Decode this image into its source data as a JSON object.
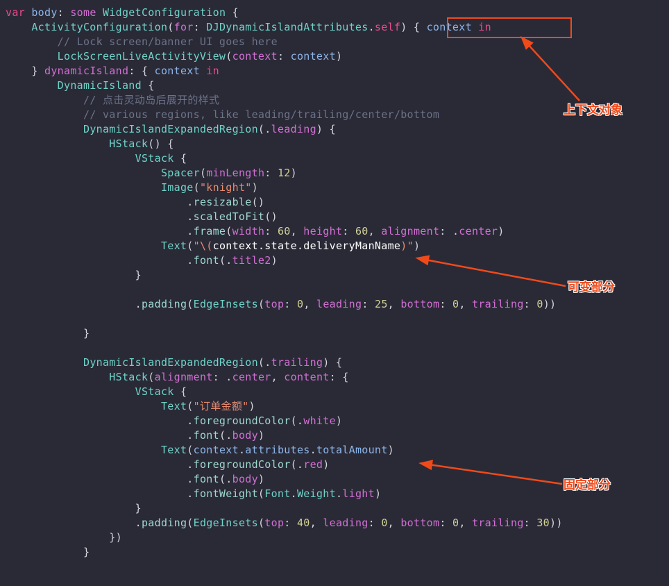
{
  "annotations": {
    "label1": "上下文对象",
    "label2": "可变部分",
    "label3": "固定部分"
  },
  "code": {
    "l1_var": "var",
    "l1_body": " body",
    "l1_colon": ": ",
    "l1_some": "some",
    "l1_type": " WidgetConfiguration",
    "l1_brace": " {",
    "l2_type": "ActivityConfiguration",
    "l2_p1": "(",
    "l2_for": "for",
    "l2_colon": ": ",
    "l2_attr": "DJDynamicIslandAttributes",
    "l2_dot": ".",
    "l2_self": "self",
    "l2_p2": ") { ",
    "l2_ctx": "context",
    "l2_in": " in",
    "l3_cmt": "// Lock screen/banner UI goes here",
    "l4_type": "LockScreenLiveActivityView",
    "l4_p1": "(",
    "l4_lbl": "context",
    "l4_colon": ": ",
    "l4_arg": "context",
    "l4_p2": ")",
    "l5_brace": "} ",
    "l5_di": "dynamicIsland",
    "l5_colon": ": { ",
    "l5_ctx": "context",
    "l5_in": " in",
    "l6_type": "DynamicIsland",
    "l6_brace": " {",
    "l7_cmt": "// 点击灵动岛后展开的样式",
    "l8_cmt": "// various regions, like leading/trailing/center/bottom",
    "l9_type": "DynamicIslandExpandedRegion",
    "l9_p1": "(.",
    "l9_enum": "leading",
    "l9_p2": ") {",
    "l10_type": "HStack",
    "l10_p": "() {",
    "l11_type": "VStack",
    "l11_brace": " {",
    "l12_type": "Spacer",
    "l12_p1": "(",
    "l12_lbl": "minLength",
    "l12_colon": ": ",
    "l12_num": "12",
    "l12_p2": ")",
    "l13_type": "Image",
    "l13_p1": "(",
    "l13_str": "\"knight\"",
    "l13_p2": ")",
    "l14_dot": ".",
    "l14_m": "resizable",
    "l14_p": "()",
    "l15_dot": ".",
    "l15_m": "scaledToFit",
    "l15_p": "()",
    "l16_dot": ".",
    "l16_m": "frame",
    "l16_p1": "(",
    "l16_w": "width",
    "l16_c1": ": ",
    "l16_n1": "60",
    "l16_s1": ", ",
    "l16_h": "height",
    "l16_c2": ": ",
    "l16_n2": "60",
    "l16_s2": ", ",
    "l16_a": "alignment",
    "l16_c3": ": .",
    "l16_e": "center",
    "l16_p2": ")",
    "l17_type": "Text",
    "l17_p1": "(",
    "l17_str1": "\"\\(",
    "l17_ctx": "context",
    "l17_d1": ".",
    "l17_st": "state",
    "l17_d2": ".",
    "l17_dn": "deliveryManName",
    "l17_str2": ")\"",
    "l17_p2": ")",
    "l18_dot": ".",
    "l18_m": "font",
    "l18_p1": "(.",
    "l18_e": "title2",
    "l18_p2": ")",
    "l19_brace": "}",
    "l20_dot": ".",
    "l20_m": "padding",
    "l20_p1": "(",
    "l20_ei": "EdgeInsets",
    "l20_p2": "(",
    "l20_t": "top",
    "l20_c1": ": ",
    "l20_n1": "0",
    "l20_s1": ", ",
    "l20_l": "leading",
    "l20_c2": ": ",
    "l20_n2": "25",
    "l20_s2": ", ",
    "l20_b": "bottom",
    "l20_c3": ": ",
    "l20_n3": "0",
    "l20_s3": ", ",
    "l20_tr": "trailing",
    "l20_c4": ": ",
    "l20_n4": "0",
    "l20_p3": "))",
    "l21_brace": "}",
    "l22_type": "DynamicIslandExpandedRegion",
    "l22_p1": "(.",
    "l22_enum": "trailing",
    "l22_p2": ") {",
    "l23_type": "HStack",
    "l23_p1": "(",
    "l23_a": "alignment",
    "l23_c1": ": .",
    "l23_e": "center",
    "l23_s1": ", ",
    "l23_ct": "content",
    "l23_c2": ": {",
    "l24_type": "VStack",
    "l24_brace": " {",
    "l25_type": "Text",
    "l25_p1": "(",
    "l25_str": "\"订单金额\"",
    "l25_p2": ")",
    "l26_dot": ".",
    "l26_m": "foregroundColor",
    "l26_p1": "(.",
    "l26_e": "white",
    "l26_p2": ")",
    "l27_dot": ".",
    "l27_m": "font",
    "l27_p1": "(.",
    "l27_e": "body",
    "l27_p2": ")",
    "l28_type": "Text",
    "l28_p1": "(",
    "l28_ctx": "context",
    "l28_d1": ".",
    "l28_at": "attributes",
    "l28_d2": ".",
    "l28_ta": "totalAmount",
    "l28_p2": ")",
    "l29_dot": ".",
    "l29_m": "foregroundColor",
    "l29_p1": "(.",
    "l29_e": "red",
    "l29_p2": ")",
    "l30_dot": ".",
    "l30_m": "font",
    "l30_p1": "(.",
    "l30_e": "body",
    "l30_p2": ")",
    "l31_dot": ".",
    "l31_m": "fontWeight",
    "l31_p1": "(",
    "l31_f": "Font",
    "l31_d1": ".",
    "l31_w": "Weight",
    "l31_d2": ".",
    "l31_l": "light",
    "l31_p2": ")",
    "l32_brace": "}",
    "l33_dot": ".",
    "l33_m": "padding",
    "l33_p1": "(",
    "l33_ei": "EdgeInsets",
    "l33_p2": "(",
    "l33_t": "top",
    "l33_c1": ": ",
    "l33_n1": "40",
    "l33_s1": ", ",
    "l33_l": "leading",
    "l33_c2": ": ",
    "l33_n2": "0",
    "l33_s2": ", ",
    "l33_b": "bottom",
    "l33_c3": ": ",
    "l33_n3": "0",
    "l33_s3": ", ",
    "l33_tr": "trailing",
    "l33_c4": ": ",
    "l33_n4": "30",
    "l33_p3": "))",
    "l34_brace": "})",
    "l35_brace": "}"
  }
}
